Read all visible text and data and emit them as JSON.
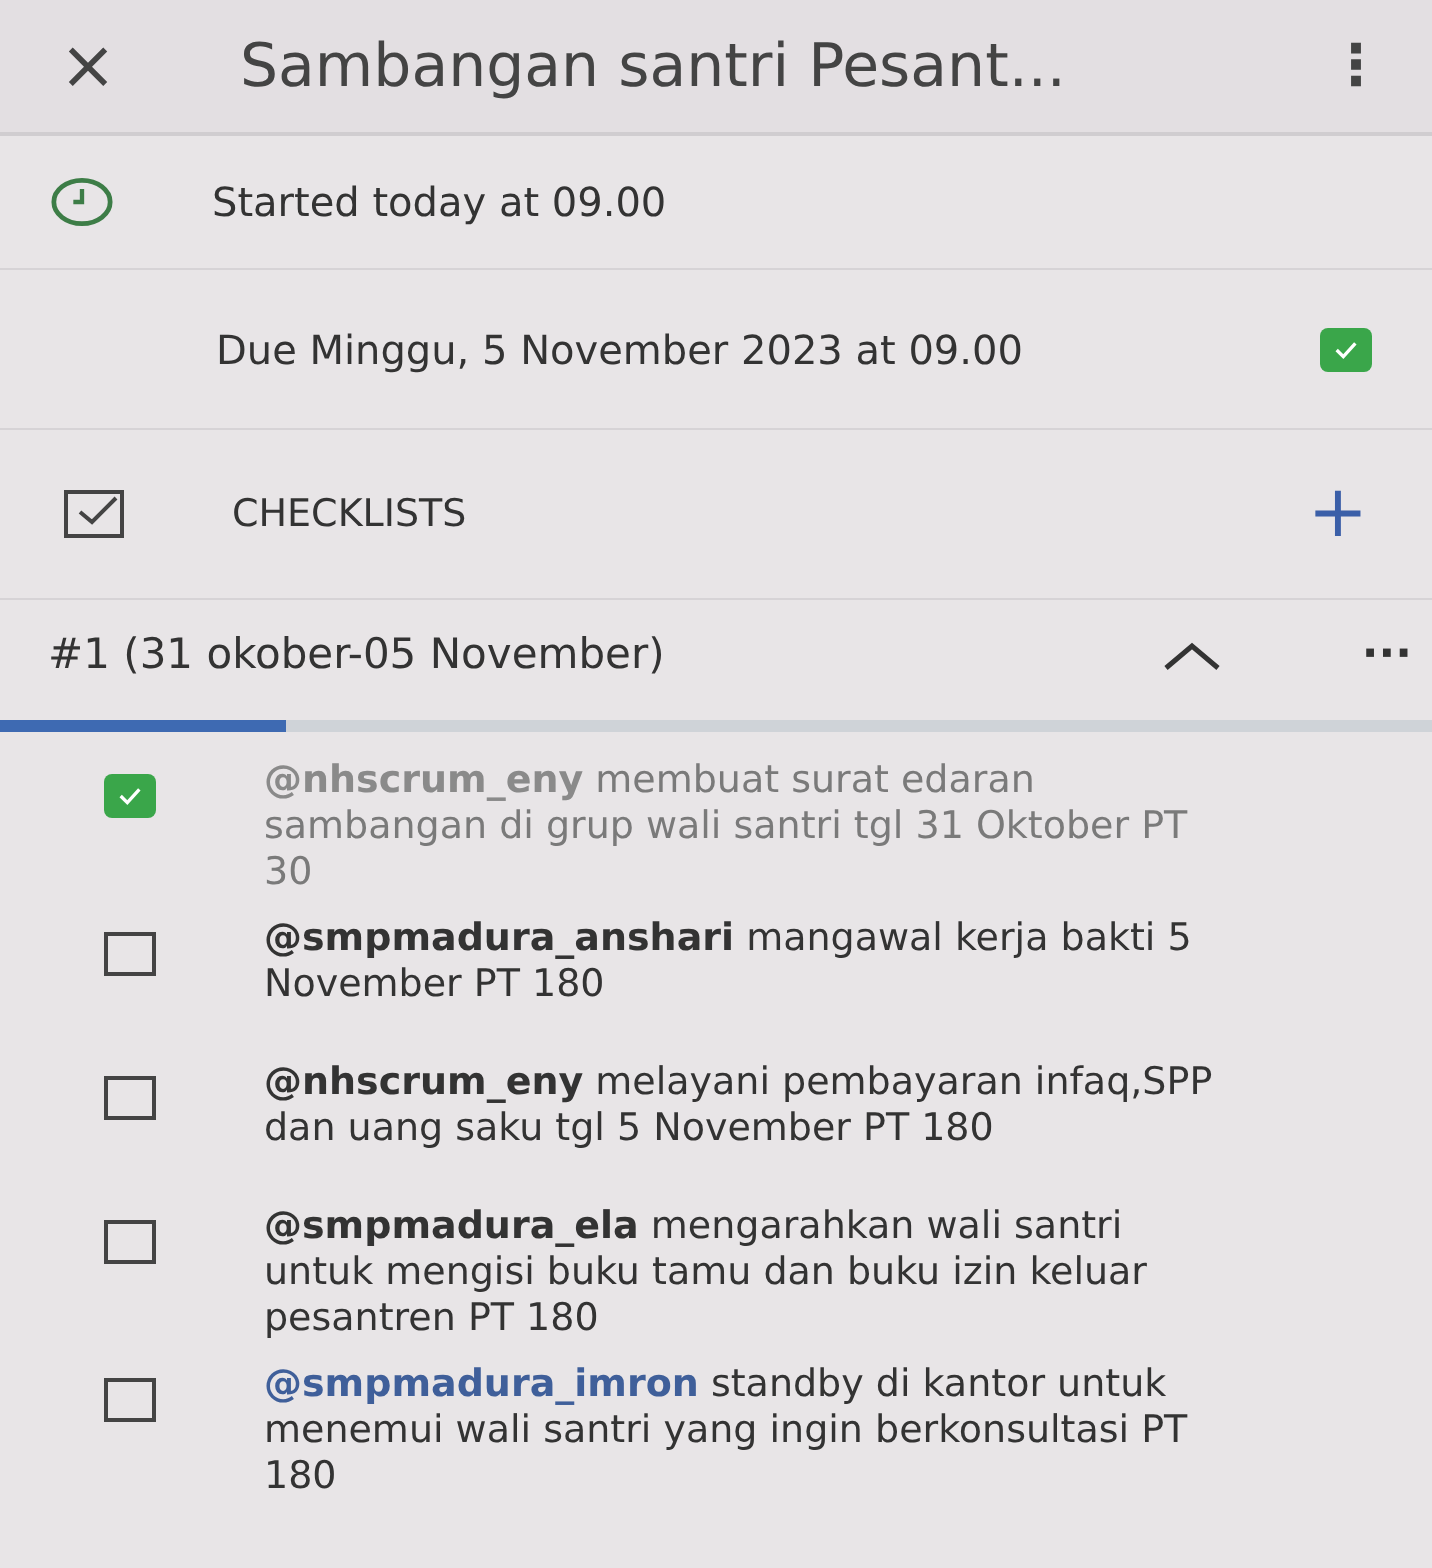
{
  "header": {
    "close": "×",
    "title": "Sambangan santri Pesant...",
    "menu": "⋮"
  },
  "started": {
    "text": "Started today at 09.00"
  },
  "due": {
    "text": "Due Minggu, 5 November 2023 at 09.00",
    "checked": true
  },
  "checklists": {
    "label": "CHECKLISTS",
    "add": "+"
  },
  "checklist": {
    "title": "#1 (31 okober-05 November)",
    "expanded": true,
    "more": "···",
    "level": 0.2,
    "items": [
      {
        "mention": "@nhscrum_eny",
        "text": " membuat surat edaran sambangan  di grup wali santri tgl 31 Oktober PT 30",
        "checked": true,
        "color": "#8a8a8a"
      },
      {
        "mention": "@smpmadura_anshari",
        "text": " mangawal kerja bakti 5 November PT 180",
        "checked": false,
        "color": "#333333"
      },
      {
        "mention": "@nhscrum_eny",
        "text": " melayani pembayaran infaq,SPP dan uang saku  tgl 5 November PT 180",
        "checked": false,
        "color": "#333333"
      },
      {
        "mention": "@smpmadura_ela",
        "text": " mengarahkan wali santri untuk mengisi buku tamu dan buku izin keluar pesantren PT 180",
        "checked": false,
        "color": "#333333"
      },
      {
        "mention": "@smpmadura_imron",
        "text": " standby di kantor untuk menemui wali santri yang ingin berkonsultasi PT 180",
        "checked": false,
        "color": "#3f5f9a"
      }
    ]
  }
}
